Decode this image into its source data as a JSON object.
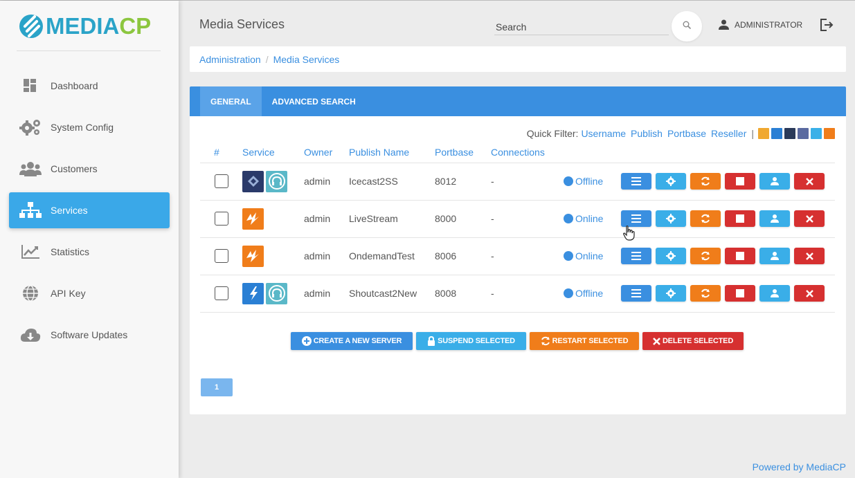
{
  "brand": {
    "part1": "MEDIA",
    "part2": "CP"
  },
  "sidebar": {
    "items": [
      {
        "label": "Dashboard",
        "icon": "dashboard-icon",
        "active": false
      },
      {
        "label": "System Config",
        "icon": "gears-icon",
        "active": false
      },
      {
        "label": "Customers",
        "icon": "users-icon",
        "active": false
      },
      {
        "label": "Services",
        "icon": "sitemap-icon",
        "active": true
      },
      {
        "label": "Statistics",
        "icon": "chart-icon",
        "active": false
      },
      {
        "label": "API Key",
        "icon": "globe-icon",
        "active": false
      },
      {
        "label": "Software Updates",
        "icon": "cloud-download-icon",
        "active": false
      }
    ]
  },
  "header": {
    "title": "Media Services",
    "search_placeholder": "Search",
    "user": "ADMINISTRATOR"
  },
  "breadcrumb": {
    "items": [
      "Administration",
      "Media Services"
    ]
  },
  "tabs": [
    {
      "label": "GENERAL",
      "active": true
    },
    {
      "label": "ADVANCED SEARCH",
      "active": false
    }
  ],
  "quick_filter": {
    "label": "Quick Filter:",
    "links": [
      "Username",
      "Publish",
      "Portbase",
      "Reseller"
    ],
    "separator": "|"
  },
  "table": {
    "headers": [
      "#",
      "Service",
      "Owner",
      "Publish Name",
      "Portbase",
      "Connections"
    ],
    "rows": [
      {
        "owner": "admin",
        "publish_name": "Icecast2SS",
        "portbase": "8012",
        "connections": "-",
        "status": "Offline",
        "icons": [
          "icecast-icon",
          "headphones-icon"
        ]
      },
      {
        "owner": "admin",
        "publish_name": "LiveStream",
        "portbase": "8000",
        "connections": "-",
        "status": "Online",
        "icons": [
          "wowza-icon"
        ]
      },
      {
        "owner": "admin",
        "publish_name": "OndemandTest",
        "portbase": "8006",
        "connections": "-",
        "status": "Online",
        "icons": [
          "wowza-icon"
        ]
      },
      {
        "owner": "admin",
        "publish_name": "Shoutcast2New",
        "portbase": "8008",
        "connections": "-",
        "status": "Offline",
        "icons": [
          "shoutcast-icon",
          "headphones-icon"
        ]
      }
    ]
  },
  "bulk_actions": {
    "create": "CREATE A NEW SERVER",
    "suspend": "SUSPEND SELECTED",
    "restart": "RESTART SELECTED",
    "delete": "DELETE SELECTED"
  },
  "pagination": {
    "current": "1"
  },
  "footer": {
    "text": "Powered by MediaCP"
  },
  "colors": {
    "primary": "#3a8fe0",
    "light_blue": "#3aaee8",
    "orange": "#f07d1a",
    "red": "#d63030",
    "sidebar_active": "#3aa8e8"
  }
}
